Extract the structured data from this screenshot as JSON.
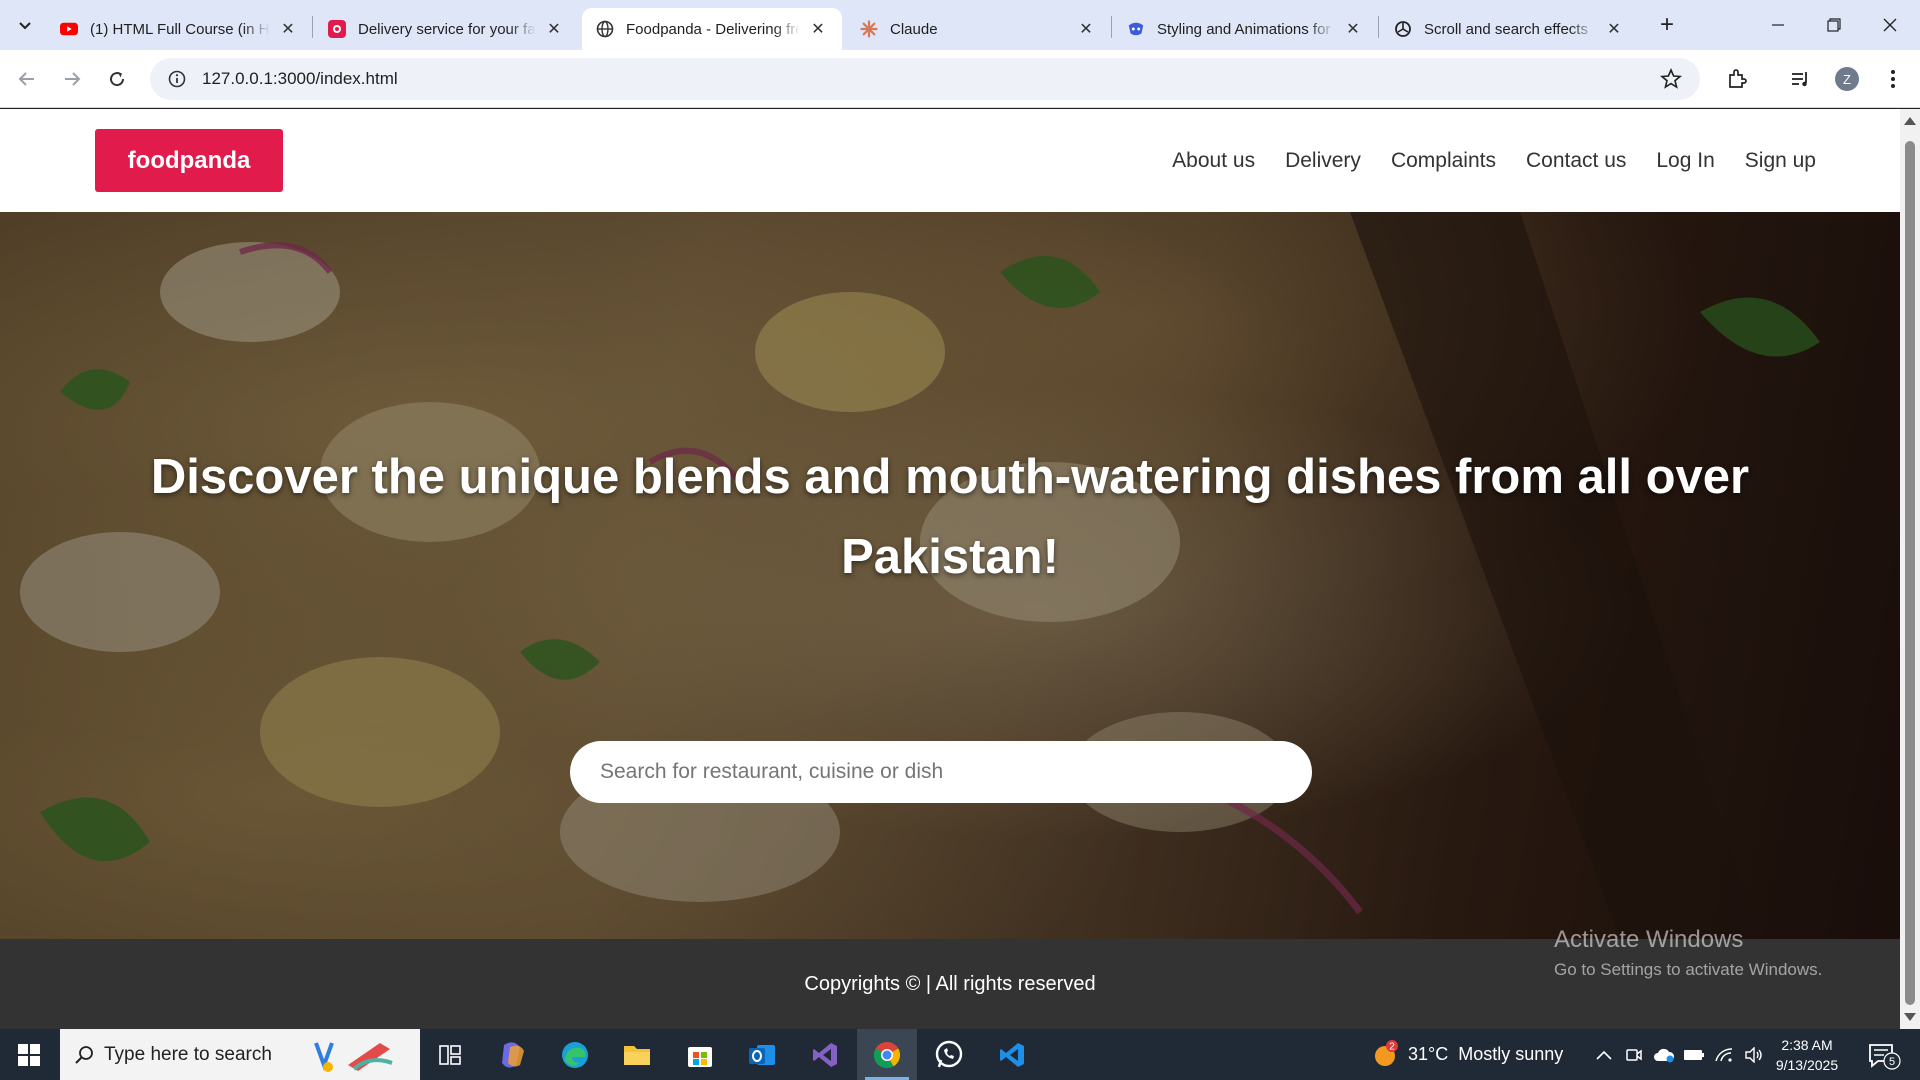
{
  "browser": {
    "tabs": [
      {
        "title": "(1) HTML Full Course (in Hi",
        "icon": "youtube-icon"
      },
      {
        "title": "Delivery service for your fa",
        "icon": "foodpanda-icon"
      },
      {
        "title": "Foodpanda - Delivering fre",
        "icon": "globe-icon",
        "active": true
      },
      {
        "title": "Claude",
        "icon": "claude-icon"
      },
      {
        "title": "Styling and Animations for",
        "icon": "copilot-icon"
      },
      {
        "title": "Scroll and search effects",
        "icon": "chatgpt-icon"
      }
    ],
    "url": "127.0.0.1:3000/index.html",
    "avatar_letter": "Z"
  },
  "site": {
    "logo": "foodpanda",
    "nav": [
      "About us",
      "Delivery",
      "Complaints",
      "Contact us",
      "Log In",
      "Sign up"
    ],
    "hero_title": "Discover the unique blends and mouth-watering dishes from all over Pakistan!",
    "search_placeholder": "Search for restaurant, cuisine or dish",
    "footer": "Copyrights © | All rights reserved",
    "brand_color": "#e21b4d"
  },
  "watermark": {
    "line1": "Activate Windows",
    "line2": "Go to Settings to activate Windows."
  },
  "taskbar": {
    "search_placeholder": "Type here to search",
    "weather": "31°C  Mostly sunny",
    "weather_badge": "2",
    "time": "2:38 AM",
    "date": "9/13/2025",
    "notifications": "5",
    "apps": [
      "task-view-icon",
      "copilot-icon",
      "edge-icon",
      "file-explorer-icon",
      "store-icon",
      "outlook-icon",
      "visual-studio-icon",
      "chrome-icon",
      "whatsapp-icon",
      "vscode-icon"
    ]
  }
}
